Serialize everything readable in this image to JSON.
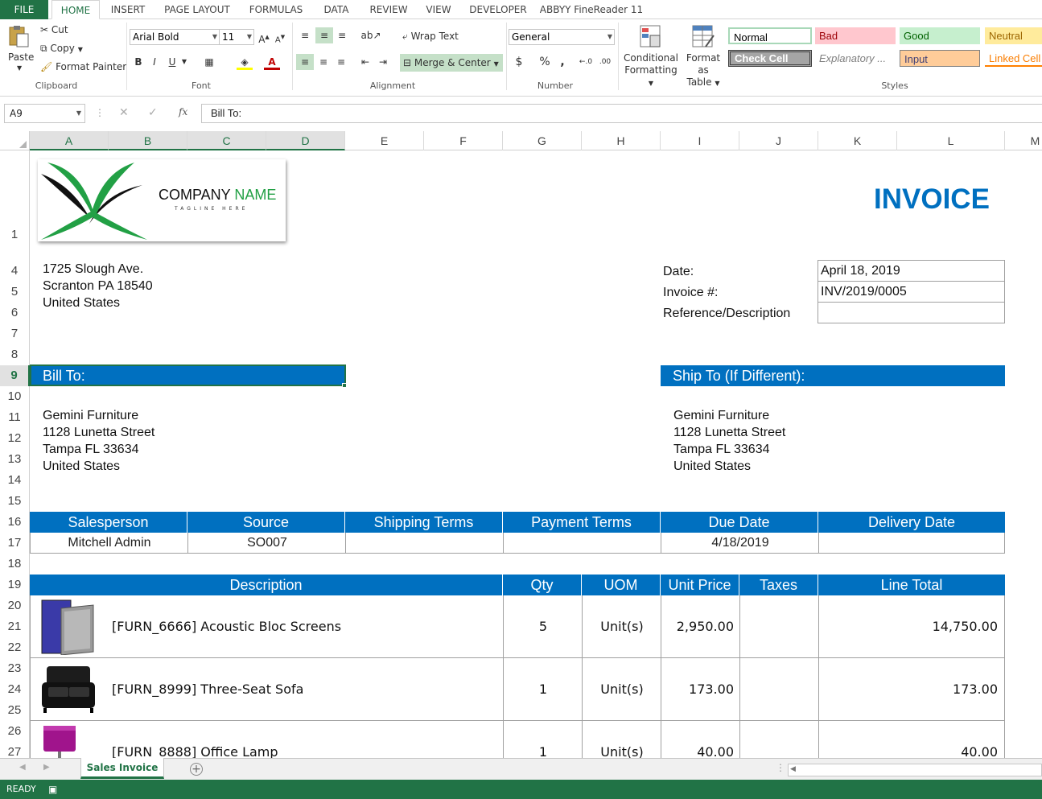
{
  "ribbon_tabs": [
    "FILE",
    "HOME",
    "INSERT",
    "PAGE LAYOUT",
    "FORMULAS",
    "DATA",
    "REVIEW",
    "VIEW",
    "DEVELOPER",
    "ABBYY FineReader 11"
  ],
  "clipboard": {
    "paste": "Paste",
    "cut": "Cut",
    "copy": "Copy",
    "format_painter": "Format Painter",
    "group": "Clipboard"
  },
  "font": {
    "name": "Arial Bold",
    "size": "11",
    "bold": "B",
    "italic": "I",
    "underline": "U",
    "group": "Font"
  },
  "alignment": {
    "wrap_text": "Wrap Text",
    "merge_center": "Merge & Center",
    "group": "Alignment"
  },
  "number": {
    "format": "General",
    "currency": "$",
    "percent": "%",
    "comma": ",",
    "group": "Number"
  },
  "styles": {
    "conditional": "Conditional",
    "formatting": "Formatting",
    "format_as": "Format as",
    "table": "Table",
    "normal": "Normal",
    "bad": "Bad",
    "good": "Good",
    "neutral": "Neutral",
    "check_cell": "Check Cell",
    "explanatory": "Explanatory ...",
    "input": "Input",
    "linked_cell": "Linked Cell",
    "group": "Styles"
  },
  "formula_bar": {
    "name_box": "A9",
    "fx": "fx",
    "content": "Bill To:"
  },
  "columns": [
    "A",
    "B",
    "C",
    "D",
    "E",
    "F",
    "G",
    "H",
    "I",
    "J",
    "K",
    "L",
    "M"
  ],
  "rows": [
    "1",
    "4",
    "5",
    "6",
    "7",
    "8",
    "9",
    "10",
    "11",
    "12",
    "13",
    "14",
    "15",
    "16",
    "17",
    "18",
    "19",
    "20",
    "21",
    "22",
    "23",
    "24",
    "25",
    "26",
    "27"
  ],
  "logo": {
    "company": "COMPANY",
    "name": "NAME",
    "tagline": "TAGLINE HERE"
  },
  "invoice_title": "INVOICE",
  "seller_address": [
    "1725 Slough Ave.",
    "Scranton PA 18540",
    "United States"
  ],
  "meta": {
    "date_label": "Date:",
    "date_value": "April 18, 2019",
    "invoice_label": "Invoice #:",
    "invoice_value": "INV/2019/0005",
    "ref_label": "Reference/Description",
    "ref_value": ""
  },
  "bill_to": {
    "label": "Bill To:",
    "lines": [
      "Gemini Furniture",
      "1128 Lunetta Street",
      "Tampa FL 33634",
      "United States"
    ]
  },
  "ship_to": {
    "label": "Ship To (If Different):",
    "lines": [
      "Gemini Furniture",
      "1128 Lunetta Street",
      "Tampa FL 33634",
      "United States"
    ]
  },
  "order_header": [
    "Salesperson",
    "Source",
    "Shipping Terms",
    "Payment Terms",
    "Due Date",
    "Delivery Date"
  ],
  "order_values": [
    "Mitchell Admin",
    "SO007",
    "",
    "",
    "4/18/2019",
    ""
  ],
  "lines_header": [
    "Description",
    "Qty",
    "UOM",
    "Unit Price",
    "Taxes",
    "Line Total"
  ],
  "lines": [
    {
      "desc": "[FURN_6666] Acoustic Bloc Screens",
      "qty": "5",
      "uom": "Unit(s)",
      "price": "2,950.00",
      "taxes": "",
      "total": "14,750.00",
      "img": "screen-image"
    },
    {
      "desc": "[FURN_8999] Three-Seat Sofa",
      "qty": "1",
      "uom": "Unit(s)",
      "price": "173.00",
      "taxes": "",
      "total": "173.00",
      "img": "sofa-image"
    },
    {
      "desc": "[FURN_8888] Office Lamp",
      "qty": "1",
      "uom": "Unit(s)",
      "price": "40.00",
      "taxes": "",
      "total": "40.00",
      "img": "lamp-image"
    }
  ],
  "sheet_tab": "Sales Invoice",
  "status": "READY"
}
